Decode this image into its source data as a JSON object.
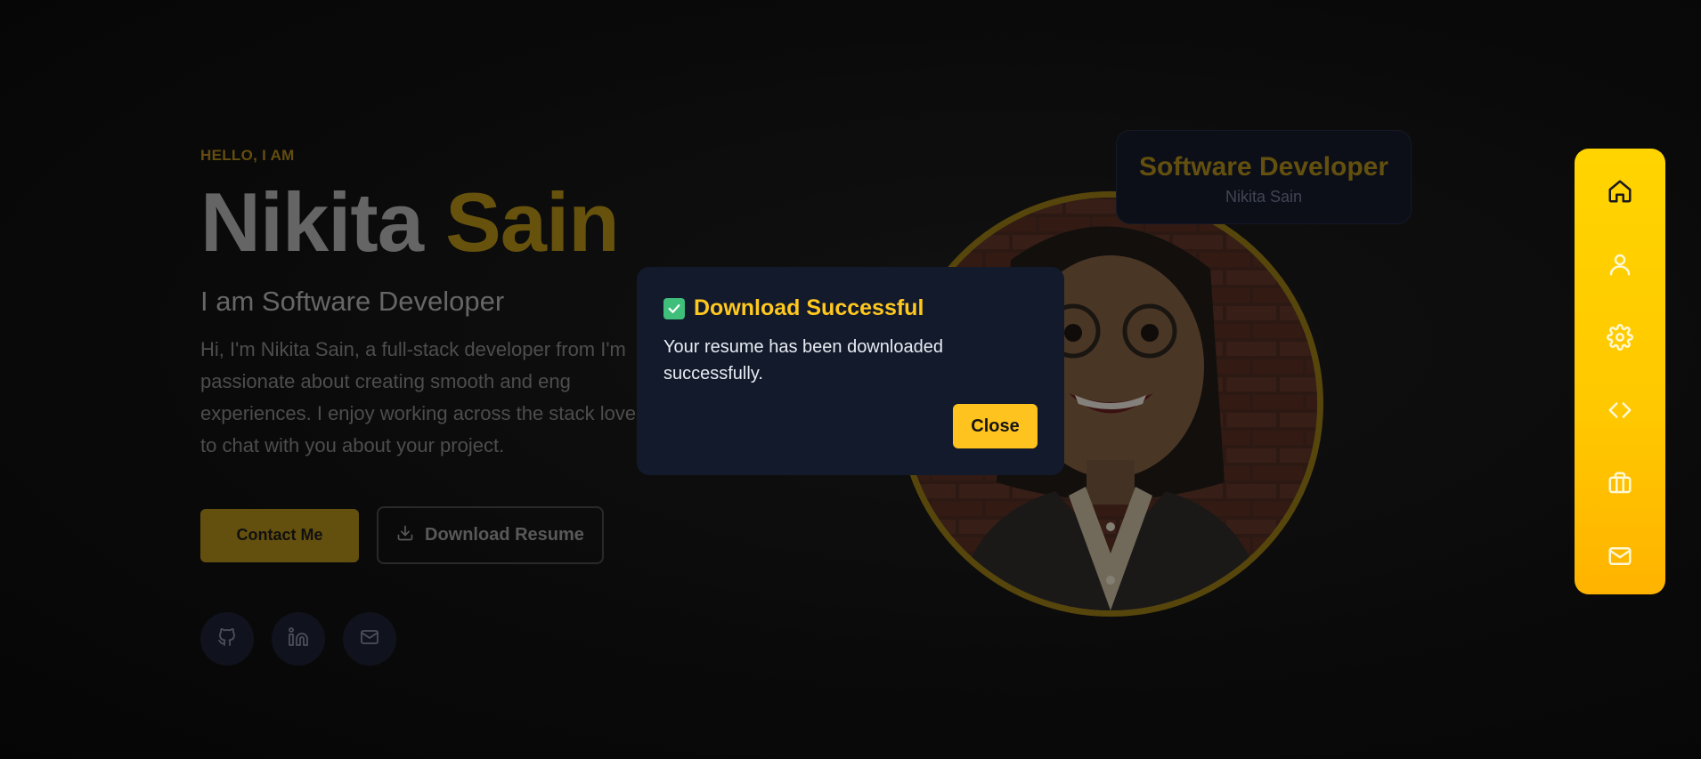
{
  "hero": {
    "eyebrow": "HELLO, I AM",
    "first_name": "Nikita",
    "last_name": "Sain",
    "role": "I am Software Developer",
    "bio": "Hi, I'm Nikita Sain, a full-stack developer from I'm passionate about creating smooth and eng experiences. I enjoy working across the stack love to chat with you about your project.",
    "contact_label": "Contact Me",
    "download_label": "Download Resume"
  },
  "socials": [
    {
      "icon": "github-icon"
    },
    {
      "icon": "linkedin-icon"
    },
    {
      "icon": "mail-icon"
    }
  ],
  "badge": {
    "title": "Software Developer",
    "subtitle": "Nikita Sain"
  },
  "nav": {
    "items": [
      {
        "icon": "home-icon"
      },
      {
        "icon": "user-icon"
      },
      {
        "icon": "gear-icon"
      },
      {
        "icon": "code-icon"
      },
      {
        "icon": "briefcase-icon"
      },
      {
        "icon": "mail-icon"
      }
    ]
  },
  "modal": {
    "title": "Download Successful",
    "message": "Your resume has been downloaded successfully.",
    "close_label": "Close"
  },
  "colors": {
    "accent": "#ffc81f",
    "nav_gradient_top": "#ffd400",
    "nav_gradient_bottom": "#ffb300",
    "modal_bg": "#121a2b",
    "success": "#3fbf7a"
  }
}
